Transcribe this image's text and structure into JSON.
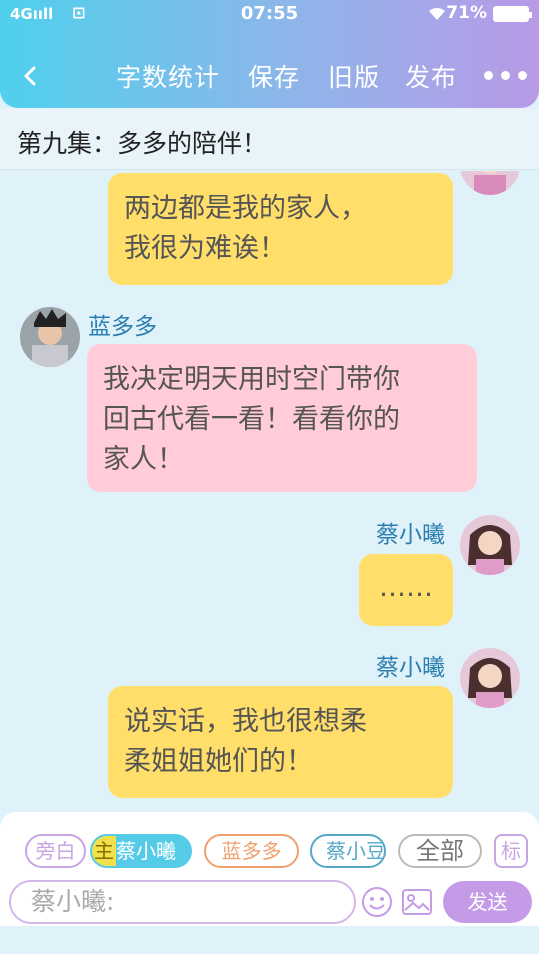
{
  "status_bar": {
    "signal": "4G",
    "time": "07:55",
    "battery": "71%"
  },
  "nav": {
    "back_icon": "chevron-left-icon",
    "word_count": "字数统计",
    "save": "保存",
    "old_version": "旧版",
    "publish": "发布",
    "more_icon": "more-icon"
  },
  "episode": {
    "title": "第九集：多多的陪伴！"
  },
  "messages": [
    {
      "speaker": "",
      "side": "right",
      "color": "#ffdf6a",
      "lines": [
        "两边都是我的家人，",
        "我很为难诶！"
      ]
    },
    {
      "speaker": "蓝多多",
      "side": "left",
      "color": "#ffccd8",
      "lines": [
        "我决定明天用时空门带你",
        "回古代看一看！看看你的",
        "家人！"
      ]
    },
    {
      "speaker": "蔡小曦",
      "side": "right",
      "color": "#ffdf6a",
      "lines": [
        "……"
      ]
    },
    {
      "speaker": "蔡小曦",
      "side": "right",
      "color": "#ffdf6a",
      "lines": [
        "说实话，我也很想柔",
        "柔姐姐她们的！"
      ]
    }
  ],
  "roles": {
    "narrator": "旁白",
    "main_tag": "主",
    "main_role": "蔡小曦",
    "role2": "蓝多多",
    "role3": "蔡小豆",
    "all": "全部",
    "mark": "标"
  },
  "composer": {
    "placeholder": "蔡小曦:",
    "send": "发送",
    "emoji_icon": "emoji-icon",
    "image_icon": "image-icon"
  }
}
